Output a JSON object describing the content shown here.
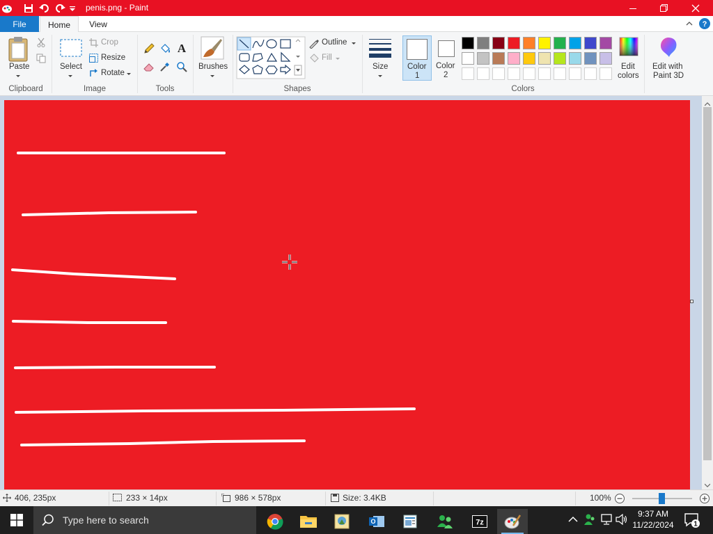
{
  "window": {
    "title": "penis.png - Paint",
    "controls": [
      "minimize",
      "restore",
      "close"
    ]
  },
  "tabs": {
    "file": "File",
    "home": "Home",
    "view": "View"
  },
  "ribbon": {
    "clipboard": {
      "paste": "Paste",
      "group": "Clipboard"
    },
    "image": {
      "select": "Select",
      "crop": "Crop",
      "resize": "Resize",
      "rotate": "Rotate",
      "group": "Image"
    },
    "tools": {
      "group": "Tools"
    },
    "brushes": {
      "label": "Brushes"
    },
    "shapes": {
      "outline": "Outline",
      "fill": "Fill",
      "group": "Shapes"
    },
    "size": {
      "label": "Size"
    },
    "colors": {
      "color1_line1": "Color",
      "color1_line2": "1",
      "color2_line1": "Color",
      "color2_line2": "2",
      "edit_line1": "Edit",
      "edit_line2": "colors",
      "group": "Colors",
      "color1_value": "#ffffff",
      "color2_value": "#ffffff",
      "palette_row1": [
        "#000000",
        "#7f7f7f",
        "#880015",
        "#ed1c24",
        "#ff7f27",
        "#fff200",
        "#22b14c",
        "#00a2e8",
        "#3f48cc",
        "#a349a4"
      ],
      "palette_row2": [
        "#ffffff",
        "#c3c3c3",
        "#b97a57",
        "#ffaec9",
        "#ffc90e",
        "#efe4b0",
        "#b5e61d",
        "#99d9ea",
        "#7092be",
        "#c8bfe7"
      ]
    },
    "paint3d": {
      "line1": "Edit with",
      "line2": "Paint 3D"
    }
  },
  "canvas": {
    "background": "#ed1c24",
    "stroke_color": "#ffffff"
  },
  "status": {
    "cursor_pos": "406, 235px",
    "selection_size": "233 × 14px",
    "image_size": "986 × 578px",
    "file_size": "Size: 3.4KB",
    "zoom": "100%",
    "zoom_level_percent": 100
  },
  "taskbar": {
    "search_placeholder": "Type here to search",
    "time": "9:37 AM",
    "date": "11/22/2024",
    "notification_count": "1",
    "apps": [
      "chrome",
      "file-explorer",
      "image-viewer",
      "outlook",
      "people",
      "7zip",
      "paint"
    ]
  }
}
